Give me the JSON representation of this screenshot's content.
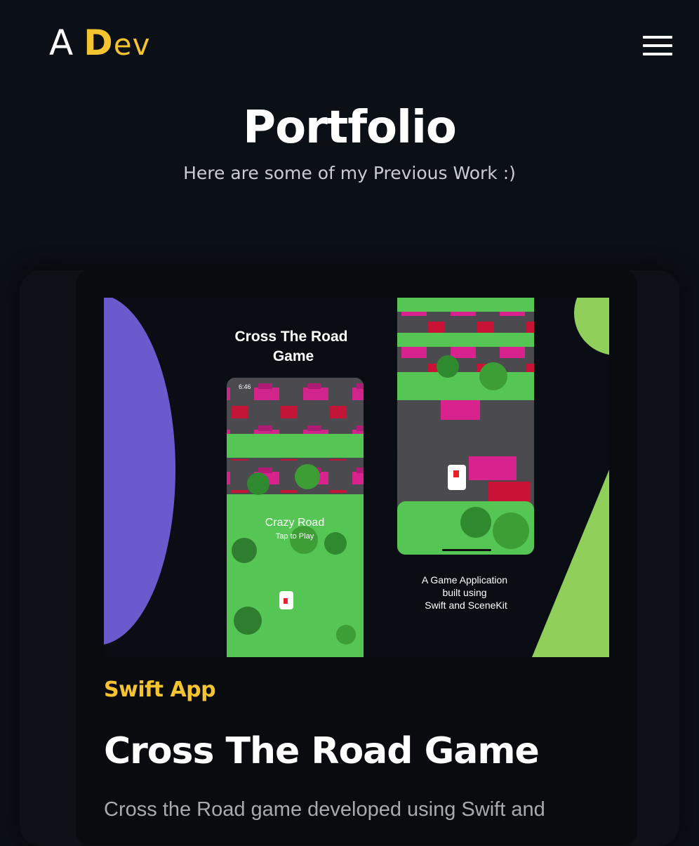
{
  "header": {
    "logo_a": "A",
    "logo_d": "D",
    "logo_ev": "ev",
    "menu_icon": "hamburger-menu-icon"
  },
  "page": {
    "title": "Portfolio",
    "subtitle": "Here are some of my Previous Work :)"
  },
  "project": {
    "image": {
      "heading_line1": "Cross The Road",
      "heading_line2": "Game",
      "status_time": "6:46",
      "game_name": "Crazy Road",
      "tap_hint": "Tap to Play",
      "caption_line1": "A Game Application",
      "caption_line2": "built using",
      "caption_line3": "Swift and SceneKit"
    },
    "tag": "Swift App",
    "title": "Cross The Road Game",
    "description": "Cross the Road game developed using Swift and"
  },
  "colors": {
    "background": "#0b0f16",
    "accent": "#f4c430",
    "purple": "#6a5acd",
    "green": "#8fcf5a",
    "road": "#4a4a4f",
    "grass": "#55c653"
  }
}
